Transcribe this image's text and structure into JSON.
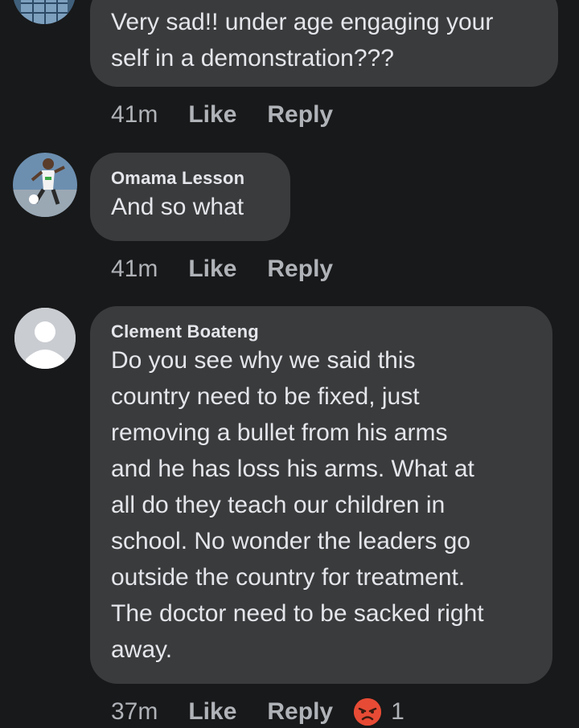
{
  "comments": [
    {
      "author": "",
      "text_lines": [
        "Very sad!! under age engaging your",
        "self in a demonstration???"
      ],
      "time": "41m",
      "like_label": "Like",
      "reply_label": "Reply"
    },
    {
      "author": "Omama Lesson",
      "text_lines": [
        "And so what"
      ],
      "time": "41m",
      "like_label": "Like",
      "reply_label": "Reply"
    },
    {
      "author": "Clement Boateng",
      "text_lines": [
        "Do you see why we said this",
        "country need to be fixed, just",
        "removing a bullet from his arms",
        "and he has loss his arms. What at",
        "all do they teach our children in",
        "school. No wonder the leaders go",
        "outside the country for treatment.",
        "The doctor need to be sacked right",
        "away."
      ],
      "time": "37m",
      "like_label": "Like",
      "reply_label": "Reply",
      "reaction": {
        "icon": "angry-reaction-icon",
        "color": "#e74b35",
        "count": "1"
      }
    }
  ],
  "theme": {
    "background": "#18191a",
    "bubble": "#3a3b3c",
    "text": "#e4e6eb",
    "muted": "#b0b3b8"
  }
}
